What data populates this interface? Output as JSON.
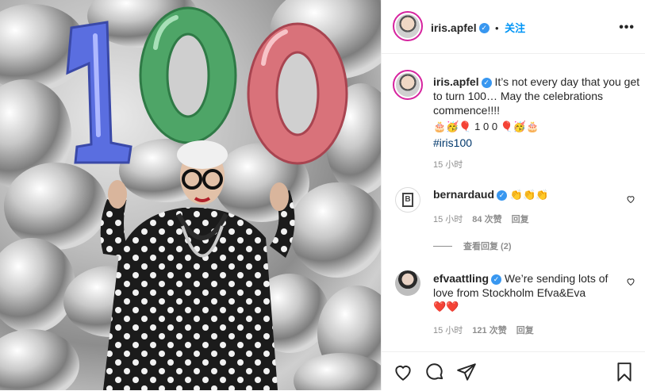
{
  "header": {
    "username": "iris.apfel",
    "follow_label": "关注",
    "dot": "•",
    "more_label": "•••"
  },
  "image": {
    "balloon_digits": [
      "1",
      "0",
      "0"
    ]
  },
  "caption": {
    "username": "iris.apfel",
    "text": "It’s not every day that you get to turn 100… May the celebrations commence!!!!",
    "emoji_line": "🎂🥳🎈 1 0 0 🎈🥳🎂",
    "hashtag": "#iris100",
    "time": "15 小时"
  },
  "comments": [
    {
      "username": "bernardaud",
      "text": "👏👏👏",
      "time": "15 小时",
      "likes": "84 次赞",
      "reply": "回复",
      "view_replies": "查看回复 (2)"
    },
    {
      "username": "efvaattling",
      "text": "We’re sending lots of love from Stockholm Efva&Eva",
      "emoji": "❤️❤️",
      "time": "15 小时",
      "likes": "121 次赞",
      "reply": "回复"
    }
  ],
  "colors": {
    "accent": "#0095f6",
    "verified": "#3897f0",
    "balloon_blue": "#5a6ee0",
    "balloon_green": "#4ea567",
    "balloon_red": "#d9727a"
  }
}
